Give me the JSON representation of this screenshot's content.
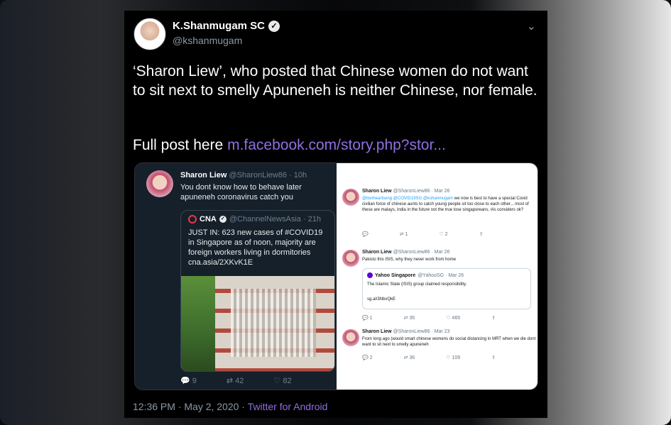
{
  "tweet": {
    "author_name": "K.Shanmugam SC",
    "verified_icon": "verified-check-icon",
    "handle": "@kshanmugam",
    "text": "‘Sharon Liew’, who posted that Chinese women do not want to sit next to smelly Apuneneh is neither Chinese, nor female.",
    "full_post_prefix": "Full post here",
    "link": "m.facebook.com/story.php?stor...",
    "timestamp": "12:36 PM · May 2, 2020 ·",
    "app": "Twitter for Android"
  },
  "embedded_left": {
    "name": "Sharon Liew",
    "meta": "@SharonLiew86 · 10h",
    "text": "You dont know how to behave later apuneneh coronavirus catch you",
    "quote": {
      "name": "CNA",
      "meta": "@ChannelNewsAsia · 21h",
      "text": "JUST IN: 623 new cases of #COVID19 in Singapore as of noon, majority are foreign workers living in dormitories cna.asia/2XKvK1E"
    },
    "actions": {
      "replies": "9",
      "retweets": "42",
      "likes": "82"
    }
  },
  "embedded_right": {
    "tweets": [
      {
        "name": "Sharon Liew",
        "meta": "@SharonLiew86 · Mar 26",
        "mentions": "@lionheartseng @COVID19SG @kshanmugam",
        "text": "we now is best to have a special Covid civilian force of chinese aunts to catch young people sit too close to each other... most of these are malays, india in the future not the true lose singaporeans. #is considers ok?",
        "replies": "",
        "retweets": "1",
        "likes": "2"
      },
      {
        "name": "Sharon Liew",
        "meta": "@SharonLiew86 · Mar 26",
        "text": "Pakisto this ISIS, why they never work from home",
        "replies": "",
        "retweets": "",
        "likes": ""
      },
      {
        "name": "Sharon Liew",
        "meta": "@SharonLiew86 · Mar 23",
        "text": "From long ago (would smart chinese womens do social distancing in MRT when we die dont want to sit next to smelly apuneneh",
        "replies": "2",
        "retweets": "36",
        "likes": "109"
      }
    ],
    "quote": {
      "name": "Yahoo Singapore",
      "meta": "@YahooSG · Mar 26",
      "text": "The Islamic State (ISIS) group claimed responsibility.",
      "link": "sg.al/3NbxQkE"
    },
    "quote_actions": {
      "replies": "1",
      "retweets": "36",
      "likes": "465"
    }
  }
}
